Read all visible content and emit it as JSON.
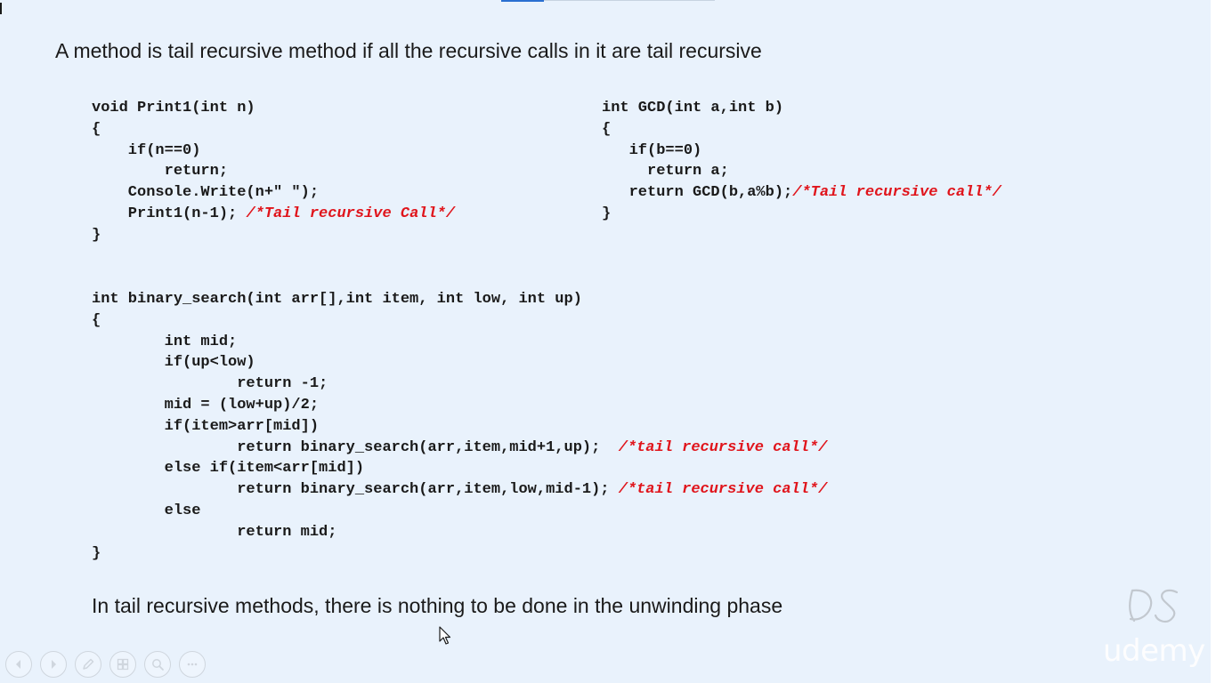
{
  "slide": {
    "heading": "A method is tail recursive method if all the recursive calls in it are tail recursive",
    "footer": "In tail recursive methods, there is nothing to be done in the unwinding phase"
  },
  "code_print1": [
    {
      "code": "void Print1(int n)",
      "comment": ""
    },
    {
      "code": "{",
      "comment": ""
    },
    {
      "code": "    if(n==0)",
      "comment": ""
    },
    {
      "code": "        return;",
      "comment": ""
    },
    {
      "code": "    Console.Write(n+\" \");",
      "comment": ""
    },
    {
      "code": "    Print1(n-1); ",
      "comment": "/*Tail recursive Call*/"
    },
    {
      "code": "}",
      "comment": ""
    }
  ],
  "code_gcd": [
    {
      "code": "int GCD(int a,int b)",
      "comment": ""
    },
    {
      "code": "{",
      "comment": ""
    },
    {
      "code": "   if(b==0)",
      "comment": ""
    },
    {
      "code": "     return a;",
      "comment": ""
    },
    {
      "code": "   return GCD(b,a%b);",
      "comment": "/*Tail recursive call*/"
    },
    {
      "code": "}",
      "comment": ""
    }
  ],
  "code_binary": [
    {
      "code": "int binary_search(int arr[],int item, int low, int up)",
      "comment": ""
    },
    {
      "code": "{",
      "comment": ""
    },
    {
      "code": "        int mid;",
      "comment": ""
    },
    {
      "code": "        if(up<low)",
      "comment": ""
    },
    {
      "code": "                return -1;",
      "comment": ""
    },
    {
      "code": "        mid = (low+up)/2;",
      "comment": ""
    },
    {
      "code": "        if(item>arr[mid])",
      "comment": ""
    },
    {
      "code": "                return binary_search(arr,item,mid+1,up);  ",
      "comment": "/*tail recursive call*/"
    },
    {
      "code": "        else if(item<arr[mid])",
      "comment": ""
    },
    {
      "code": "                return binary_search(arr,item,low,mid-1); ",
      "comment": "/*tail recursive call*/"
    },
    {
      "code": "        else",
      "comment": ""
    },
    {
      "code": "                return mid;",
      "comment": ""
    },
    {
      "code": "}",
      "comment": ""
    }
  ],
  "player_controls": [
    {
      "name": "previous-slide-button",
      "icon": "chevron-left-icon"
    },
    {
      "name": "next-slide-button",
      "icon": "chevron-right-icon"
    },
    {
      "name": "pen-tool-button",
      "icon": "pen-icon"
    },
    {
      "name": "slides-overview-button",
      "icon": "slides-grid-icon"
    },
    {
      "name": "zoom-button",
      "icon": "magnifier-icon"
    },
    {
      "name": "more-options-button",
      "icon": "more-icon"
    }
  ],
  "branding": {
    "watermark": "udemy"
  },
  "colors": {
    "slide_background": "#e9f2fc",
    "text": "#1a1a1a",
    "comment": "#e0141b"
  }
}
